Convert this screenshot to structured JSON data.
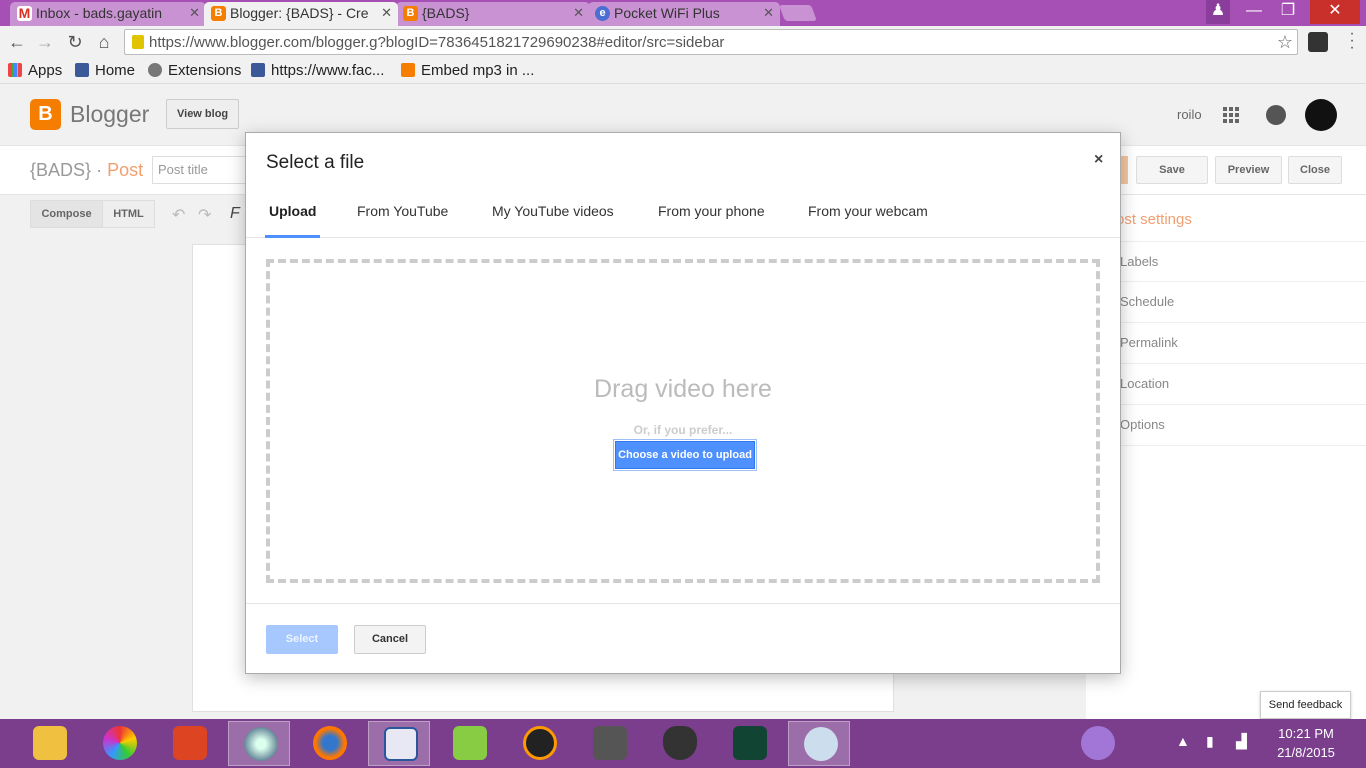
{
  "browser": {
    "tabs": [
      {
        "title": "Inbox - bads.gayatin",
        "icon": "gmail-icon",
        "color": "#d93025"
      },
      {
        "title": "Blogger: {BADS} - Cre",
        "icon": "blogger-icon",
        "color": "#f57d00"
      },
      {
        "title": "{BADS}",
        "icon": "blogger-icon",
        "color": "#f57d00"
      },
      {
        "title": "Pocket WiFi Plus",
        "icon": "globe-icon",
        "color": "#4a6fd1"
      }
    ],
    "url": "https://www.blogger.com/blogger.g?blogID=7836451821729690238#editor/src=sidebar",
    "bookmarks": [
      "Apps",
      "Home",
      "Extensions",
      "https://www.fac...",
      "Embed mp3 in ..."
    ]
  },
  "blogger": {
    "logo_text": "Blogger",
    "view_blog": "View blog",
    "user": "roilo",
    "blog_name": "{BADS}",
    "separator": "·",
    "post_label": "Post",
    "post_title_placeholder": "Post title",
    "buttons": {
      "save": "Save",
      "preview": "Preview",
      "close": "Close"
    },
    "compose": "Compose",
    "html": "HTML",
    "post_settings": {
      "title": "ost settings",
      "items": [
        "Labels",
        "Schedule",
        "Permalink",
        "Location",
        "Options"
      ]
    },
    "send_feedback": "Send feedback"
  },
  "dialog": {
    "title": "Select a file",
    "close": "×",
    "tabs": [
      "Upload",
      "From YouTube",
      "My YouTube videos",
      "From your phone",
      "From your webcam"
    ],
    "active_tab": "Upload",
    "drag_text": "Drag video here",
    "prefer_text": "Or, if you prefer...",
    "choose_button": "Choose a video to upload",
    "select_button": "Select",
    "cancel_button": "Cancel"
  },
  "taskbar": {
    "time": "10:21 PM",
    "date": "21/8/2015"
  },
  "colors": {
    "accent_blue": "#4d90fe",
    "blogger_orange": "#f57d00",
    "tabstrip": "#a64fb4",
    "taskbar": "#7a3e8c"
  }
}
